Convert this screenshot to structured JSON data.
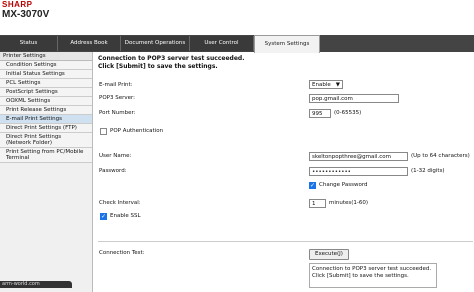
{
  "header": {
    "brand": "SHARP",
    "model": "MX-3070V"
  },
  "tabs": [
    {
      "label": "Status"
    },
    {
      "label": "Address Book"
    },
    {
      "label": "Document Operations"
    },
    {
      "label": "User Control"
    },
    {
      "label": "System Settings"
    }
  ],
  "sidebar": {
    "group_label": "Printer Settings",
    "items": [
      {
        "label": "Condition Settings"
      },
      {
        "label": "Initial Status Settings"
      },
      {
        "label": "PCL Settings"
      },
      {
        "label": "PostScript Settings"
      },
      {
        "label": "OOXML Settings"
      },
      {
        "label": "Print Release Settings"
      },
      {
        "label": "E-mail Print Settings"
      },
      {
        "label": "Direct Print Settings (FTP)"
      },
      {
        "label": "Direct Print Settings (Network Folder)"
      },
      {
        "label": "Print Setting from PC/Mobile Terminal"
      }
    ]
  },
  "main": {
    "message_line1": "Connection to POP3 server test succeeded.",
    "message_line2": "Click [Submit] to save the settings.",
    "email_print_label": "E-mail Print:",
    "email_print_value": "Enable",
    "pop3_server_label": "POP3 Server:",
    "pop3_server_value": "pop.gmail.com",
    "port_label": "Port Number:",
    "port_value": "995",
    "port_hint": "(0-65535)",
    "pop_auth_label": "POP Authentication",
    "username_label": "User Name:",
    "username_value": "skeltonpopthree@gmail.com",
    "username_hint": "(Up to 64 characters)",
    "password_label": "Password:",
    "password_value": "••••••••••••",
    "password_hint": "(1-32 digits)",
    "change_password_label": "Change Password",
    "check_interval_label": "Check Interval:",
    "check_interval_value": "1",
    "check_interval_hint": "minutes(1-60)",
    "enable_ssl_label": "Enable SSL",
    "connection_test_label": "Connection Test:",
    "execute_label": "Execute(J)",
    "result_line1": "Connection to POP3 server test succeeded.",
    "result_line2": "Click [Submit] to save the settings."
  },
  "statusbar": {
    "text": "arm-world.com"
  }
}
